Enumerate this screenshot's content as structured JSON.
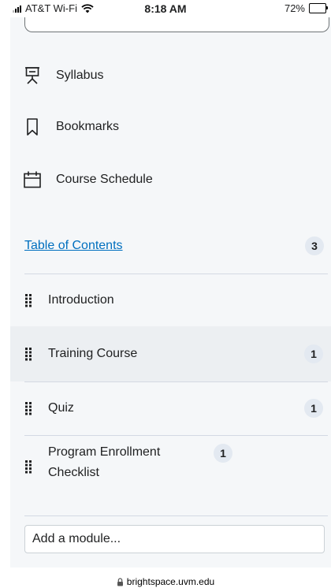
{
  "status_bar": {
    "carrier": "AT&T Wi-Fi",
    "time": "8:18 AM",
    "battery": "72%",
    "battery_level": 0.72
  },
  "nav": {
    "items": [
      {
        "label": "Syllabus",
        "icon": "presentation-board-icon"
      },
      {
        "label": "Bookmarks",
        "icon": "bookmark-icon"
      },
      {
        "label": "Course Schedule",
        "icon": "calendar-icon"
      }
    ]
  },
  "toc": {
    "label": "Table of Contents",
    "count": "3"
  },
  "modules": [
    {
      "label": "Introduction",
      "count": ""
    },
    {
      "label": "Training Course",
      "count": "1"
    },
    {
      "label": "Quiz",
      "count": "1"
    },
    {
      "label": "Program Enrollment Checklist",
      "count": "1"
    }
  ],
  "add_module": {
    "placeholder": "Add a module..."
  },
  "url_bar": {
    "url": "brightspace.uvm.edu",
    "icon": "lock-icon"
  },
  "colors": {
    "link": "#006fbf",
    "panel_bg": "#f5f7f9",
    "badge_bg": "#e3e9f1"
  }
}
